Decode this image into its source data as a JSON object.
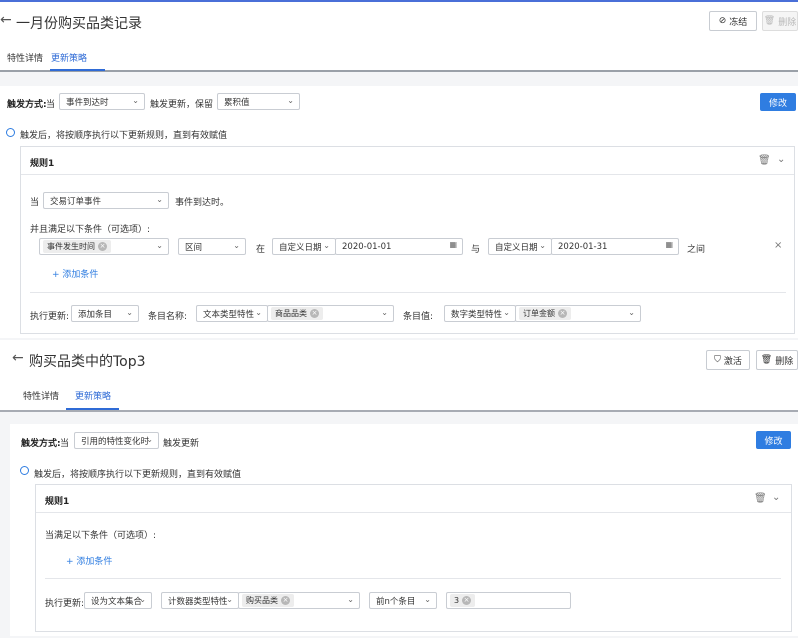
{
  "colors": {
    "accent": "#2f7de1",
    "tab_active": "#2f6bd6"
  },
  "section1": {
    "title": "一月份购买品类记录",
    "back_icon": "←",
    "freeze_label": "冻结",
    "delete_label": "删除",
    "tabs": [
      "特性详情",
      "更新策略"
    ],
    "trigger_label": "触发方式:",
    "trigger_when": "当",
    "trigger_select": "事件到达时",
    "trigger_mid": "触发更新，保留",
    "keep_select": "累积值",
    "edit_label": "修改",
    "radio_text": "触发后，将按顺序执行以下更新规则，直到有效赋值",
    "rule_title": "规则1",
    "when_label": "当",
    "event_select": "交易订单事件",
    "event_suffix": "事件到达时。",
    "condition_label": "并且满足以下条件（可选项）:",
    "cond_tag": "事件发生时间",
    "range_select": "区间",
    "in_label": "在",
    "custom_date1": "自定义日期",
    "date1": "2020-01-01",
    "and_label": "与",
    "custom_date2": "自定义日期",
    "date2": "2020-01-31",
    "between_label": "之间",
    "add_condition": "添加条件",
    "exec_label": "执行更新:",
    "exec_select": "添加条目",
    "item_name_label": "条目名称:",
    "item_name_select": "文本类型特性",
    "item_name_tag": "商品品类",
    "item_value_label": "条目值:",
    "item_value_select": "数字类型特性",
    "item_value_tag": "订单金额"
  },
  "section2": {
    "title": "购买品类中的Top3",
    "back_icon": "←",
    "activate_label": "激活",
    "delete_label": "删除",
    "tabs": [
      "特性详情",
      "更新策略"
    ],
    "trigger_label": "触发方式:",
    "trigger_when": "当",
    "trigger_select": "引用的特性变化时",
    "trigger_mid": "触发更新",
    "edit_label": "修改",
    "radio_text": "触发后，将按顺序执行以下更新规则，直到有效赋值",
    "rule_title": "规则1",
    "condition_label": "当满足以下条件（可选项）:",
    "add_condition": "添加条件",
    "exec_label": "执行更新:",
    "exec_select": "设为文本集合",
    "counter_select": "计数器类型特性",
    "counter_tag": "购买品类",
    "topn_select": "前n个条目",
    "n_tag": "3"
  }
}
